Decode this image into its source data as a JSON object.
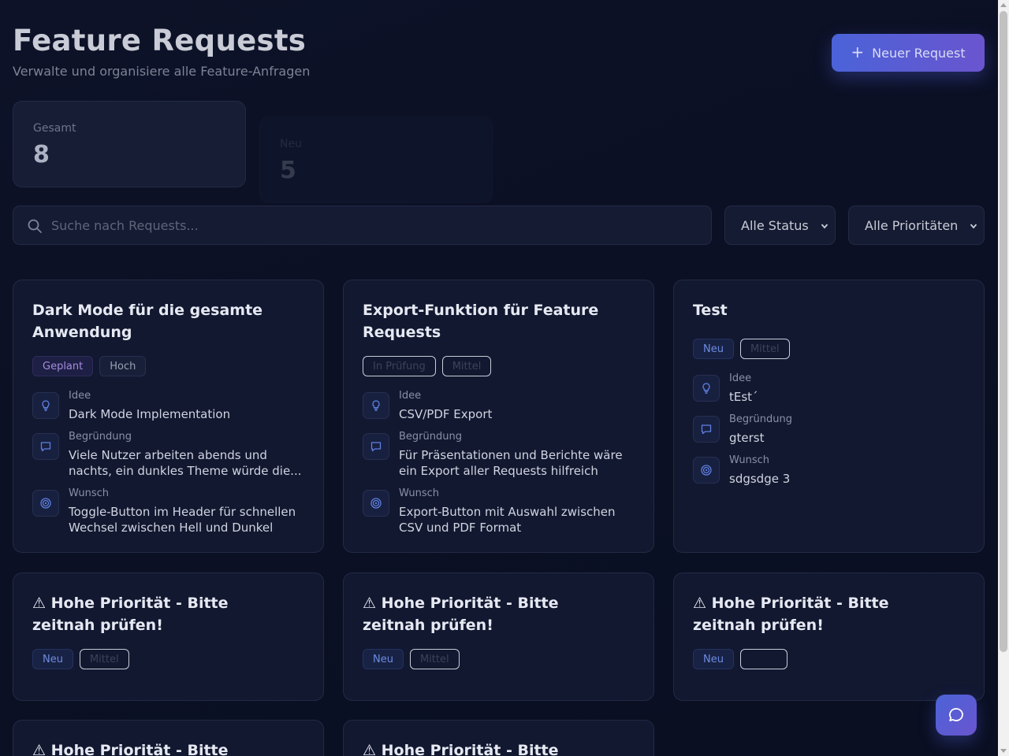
{
  "header": {
    "title": "Feature Requests",
    "subtitle": "Verwalte und organisiere alle Feature-Anfragen",
    "new_button": "Neuer Request"
  },
  "stats": [
    {
      "label": "Gesamt",
      "value": "8"
    },
    {
      "label": "Neu",
      "value": "5"
    }
  ],
  "filters": {
    "search_placeholder": "Suche nach Requests...",
    "status_selected": "Alle Status",
    "priority_selected": "Alle Prioritäten"
  },
  "cards": [
    {
      "title": "Dark Mode für die gesamte Anwendung",
      "status": "Geplant",
      "priority": "Hoch",
      "fields": [
        {
          "label": "Idee",
          "value": "Dark Mode Implementation",
          "icon": "lightbulb-icon"
        },
        {
          "label": "Begründung",
          "value": "Viele Nutzer arbeiten abends und nachts, ein dunkles Theme würde die...",
          "icon": "message-icon"
        },
        {
          "label": "Wunsch",
          "value": "Toggle-Button im Header für schnellen Wechsel zwischen Hell und Dunkel",
          "icon": "target-icon"
        }
      ]
    },
    {
      "title": "Export-Funktion für Feature Requests",
      "status": "In Prüfung",
      "priority": "Mittel",
      "fields": [
        {
          "label": "Idee",
          "value": "CSV/PDF Export",
          "icon": "lightbulb-icon"
        },
        {
          "label": "Begründung",
          "value": "Für Präsentationen und Berichte wäre ein Export aller Requests hilfreich",
          "icon": "message-icon"
        },
        {
          "label": "Wunsch",
          "value": "Export-Button mit Auswahl zwischen CSV und PDF Format",
          "icon": "target-icon"
        }
      ]
    },
    {
      "title": "Test",
      "status": "Neu",
      "priority": "Mittel",
      "fields": [
        {
          "label": "Idee",
          "value": "tEst´",
          "icon": "lightbulb-icon"
        },
        {
          "label": "Begründung",
          "value": "gterst",
          "icon": "message-icon"
        },
        {
          "label": "Wunsch",
          "value": "sdgsdge 3",
          "icon": "target-icon"
        }
      ]
    },
    {
      "title": "⚠ Hohe Priorität - Bitte zeitnah prüfen!",
      "status": "Neu",
      "priority": "Mittel"
    },
    {
      "title": "⚠ Hohe Priorität - Bitte zeitnah prüfen!",
      "status": "Neu",
      "priority": "Mittel"
    },
    {
      "title": "⚠ Hohe Priorität - Bitte zeitnah prüfen!",
      "status": "Neu",
      "priority": ""
    },
    {
      "title": "⚠ Hohe Priorität - Bitte"
    },
    {
      "title": "⚠ Hohe Priorität - Bitte"
    }
  ],
  "colors": {
    "accent_start": "#4b63d8",
    "accent_end": "#6a55cf",
    "background": "#0b1024",
    "card": "#121830"
  }
}
